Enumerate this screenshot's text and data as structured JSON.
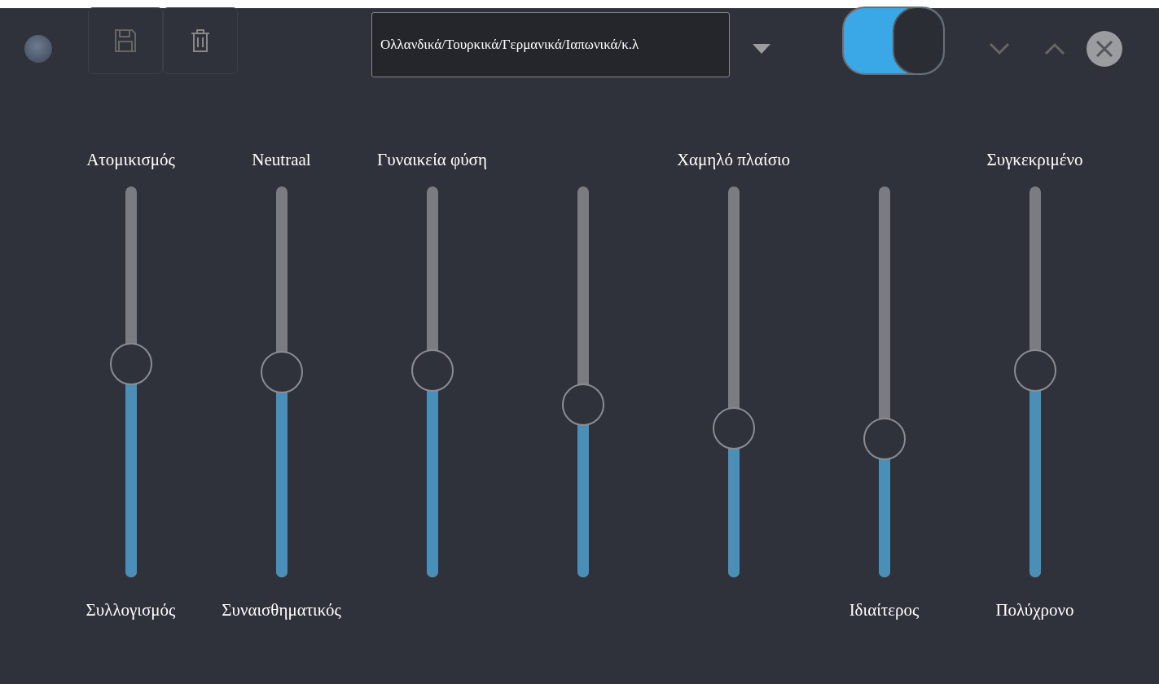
{
  "toolbar": {
    "language": "Ολλανδικά/Τουρκικά/Γερμανικά/Ιαπωνικά/κ.λ",
    "toggle_on": true
  },
  "sliders": [
    {
      "top_label": "Ατομικισμός",
      "bottom_label": "Συλλογισμός",
      "level": 0.545
    },
    {
      "top_label": "Neutraal",
      "bottom_label": "Συναισθηματικός",
      "level": 0.525
    },
    {
      "top_label": "Γυναικεία φύση",
      "level": 0.529
    },
    {
      "level": 0.442
    },
    {
      "top_label": "Χαμηλό πλαίσιο",
      "level": 0.381
    },
    {
      "bottom_label": "Ιδιαίτερος",
      "level": 0.354
    },
    {
      "top_label": "Συγκεκριμένο",
      "bottom_label": "Πολύχρονο",
      "level": 0.529
    }
  ]
}
